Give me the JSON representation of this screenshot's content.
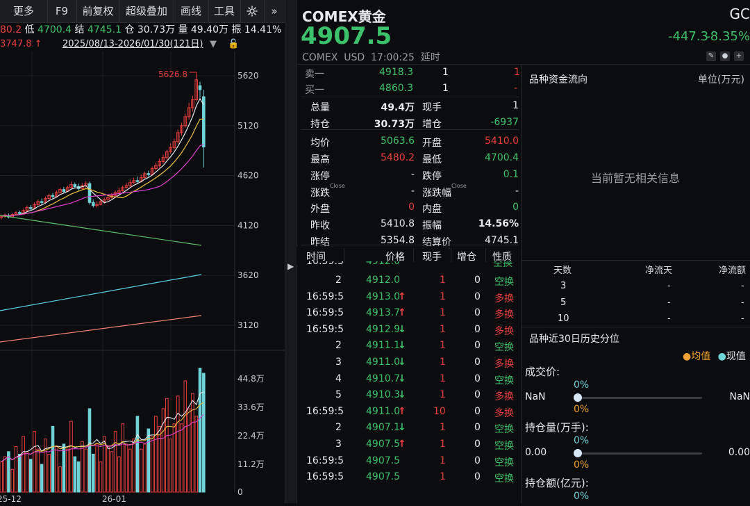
{
  "toolbar": {
    "items": [
      "更多",
      "F9",
      "前复权",
      "超级叠加",
      "画线",
      "工具"
    ],
    "gear_icon": "gear-icon",
    "more_icon": "chevrons-right-icon"
  },
  "quote_bar": {
    "high_partial": "80.2",
    "low_label": "低",
    "low_value": "4700.4",
    "settle_label": "结",
    "settle_value": "4745.1",
    "oi_label": "仓",
    "oi_value": "30.73万",
    "vol_label": "量",
    "vol_value": "49.40万",
    "amp_label": "振",
    "amp_value": "14.41%"
  },
  "range_bar": {
    "low_marker": "3747.8",
    "date_range": "2025/08/13-2026/01/30(121日)"
  },
  "chart": {
    "price_ticks": [
      "5620",
      "5120",
      "4620",
      "4120",
      "3620",
      "3120"
    ],
    "volume_ticks": [
      "44.8万",
      "33.6万",
      "22.4万",
      "11.2万",
      "0"
    ],
    "x_labels": [
      "25-12",
      "26-01"
    ],
    "high_marker": "5626.8"
  },
  "instrument": {
    "name": "COMEX黄金",
    "code": "GC",
    "price": "4907.5",
    "change": "-447.3",
    "change_pct": "-8.35%",
    "sub": "COMEX  USD  17:00:25  延时"
  },
  "orderbook": [
    {
      "label": "卖一",
      "price": "4918.3",
      "qty": "1",
      "chg": "1"
    },
    {
      "label": "买一",
      "price": "4860.3",
      "qty": "1",
      "chg": "-"
    }
  ],
  "stats": [
    {
      "l1": "总量",
      "v1": "49.4万",
      "l2": "现手",
      "v2": "1"
    },
    {
      "l1": "持仓",
      "v1": "30.73万",
      "l2": "增仓",
      "v2": "-6937"
    },
    {
      "l1": "均价",
      "v1": "5063.6",
      "l2": "开盘",
      "v2": "5410.0"
    },
    {
      "l1": "最高",
      "v1": "5480.2",
      "l2": "最低",
      "v2": "4700.4"
    },
    {
      "l1": "涨停",
      "v1": "-",
      "l2": "跌停",
      "v2": "0.1"
    },
    {
      "l1": "涨跌",
      "v1": "-",
      "l2": "涨跌幅",
      "v2": "-"
    },
    {
      "l1": "外盘",
      "v1": "0",
      "l2": "内盘",
      "v2": "0"
    },
    {
      "l1": "昨收",
      "v1": "5410.8",
      "l2": "振幅",
      "v2": "14.56%"
    },
    {
      "l1": "昨结",
      "v1": "5354.8",
      "l2": "结算价",
      "v2": "4745.1"
    }
  ],
  "close_sup": "Close",
  "trades_header": [
    "时间",
    "价格",
    "现手",
    "增仓",
    "性质"
  ],
  "trades_partial": {
    "time": "16:59:5",
    "price": "4912.0",
    "nature": "空换"
  },
  "trades": [
    {
      "time": "2",
      "price": "4912.0",
      "arrow": "",
      "qty": "1",
      "oi": "0",
      "nature": "空换"
    },
    {
      "time": "16:59:5",
      "price": "4913.0",
      "arrow": "up",
      "qty": "1",
      "oi": "0",
      "nature": "多换"
    },
    {
      "time": "16:59:5",
      "price": "4913.7",
      "arrow": "up",
      "qty": "1",
      "oi": "0",
      "nature": "多换"
    },
    {
      "time": "16:59:5",
      "price": "4912.9",
      "arrow": "down",
      "qty": "1",
      "oi": "0",
      "nature": "多换"
    },
    {
      "time": "2",
      "price": "4911.1",
      "arrow": "down",
      "qty": "1",
      "oi": "0",
      "nature": "空换"
    },
    {
      "time": "3",
      "price": "4911.0",
      "arrow": "down",
      "qty": "1",
      "oi": "0",
      "nature": "多换"
    },
    {
      "time": "4",
      "price": "4910.7",
      "arrow": "down",
      "qty": "1",
      "oi": "0",
      "nature": "空换"
    },
    {
      "time": "5",
      "price": "4910.3",
      "arrow": "down",
      "qty": "1",
      "oi": "0",
      "nature": "多换"
    },
    {
      "time": "16:59:5",
      "price": "4911.0",
      "arrow": "up",
      "qty": "10",
      "oi": "0",
      "nature": "多换"
    },
    {
      "time": "2",
      "price": "4907.1",
      "arrow": "down",
      "qty": "1",
      "oi": "0",
      "nature": "空换"
    },
    {
      "time": "3",
      "price": "4907.5",
      "arrow": "up",
      "qty": "1",
      "oi": "0",
      "nature": "空换"
    },
    {
      "time": "16:59:5",
      "price": "4907.5",
      "arrow": "",
      "qty": "1",
      "oi": "0",
      "nature": "空换"
    },
    {
      "time": "16:59:5",
      "price": "4907.5",
      "arrow": "",
      "qty": "1",
      "oi": "0",
      "nature": "空换"
    }
  ],
  "fund_flow": {
    "title": "品种资金流向",
    "unit": "单位(万元)",
    "empty": "当前暂无相关信息",
    "cols": [
      "天数",
      "净流天",
      "净流额"
    ],
    "rows": [
      {
        "days": "3",
        "a": "-",
        "b": "-"
      },
      {
        "days": "5",
        "a": "-",
        "b": "-"
      },
      {
        "days": "10",
        "a": "-",
        "b": "-"
      }
    ]
  },
  "percentile": {
    "title": "品种近30日历史分位",
    "legend_avg": "均值",
    "legend_cur": "现值",
    "sections": [
      {
        "label": "成交价:",
        "top": "0%",
        "left": "NaN",
        "right": "NaN",
        "bottom": "0%"
      },
      {
        "label": "持仓量(万手):",
        "top": "0%",
        "left": "0.00",
        "right": "0.00",
        "bottom": "0%"
      },
      {
        "label": "持仓额(亿元):",
        "top": "0%",
        "left": "",
        "right": "",
        "bottom": ""
      }
    ]
  },
  "colors": {
    "up": "#e8403d",
    "down": "#3cc26a",
    "accent": "#6fd3d8",
    "avg": "#f0a030"
  }
}
